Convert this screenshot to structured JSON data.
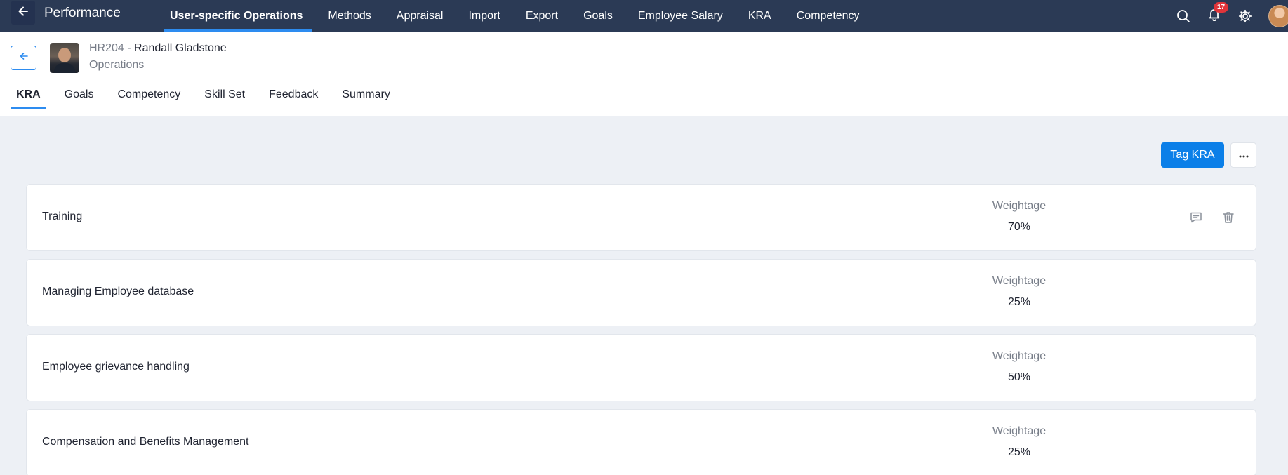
{
  "topbar": {
    "title": "Performance",
    "nav": [
      {
        "label": "User-specific Operations"
      },
      {
        "label": "Methods"
      },
      {
        "label": "Appraisal"
      },
      {
        "label": "Import"
      },
      {
        "label": "Export"
      },
      {
        "label": "Goals"
      },
      {
        "label": "Employee Salary"
      },
      {
        "label": "KRA"
      },
      {
        "label": "Competency"
      }
    ],
    "notification_count": "17"
  },
  "employee": {
    "id": "HR204",
    "separator": " - ",
    "name": "Randall Gladstone",
    "department": "Operations"
  },
  "tabs": [
    {
      "label": "KRA"
    },
    {
      "label": "Goals"
    },
    {
      "label": "Competency"
    },
    {
      "label": "Skill Set"
    },
    {
      "label": "Feedback"
    },
    {
      "label": "Summary"
    }
  ],
  "actions": {
    "tag_label": "Tag KRA"
  },
  "kras": [
    {
      "name": "Training",
      "weight_label": "Weightage",
      "weight": "70%"
    },
    {
      "name": "Managing Employee database",
      "weight_label": "Weightage",
      "weight": "25%"
    },
    {
      "name": "Employee grievance handling",
      "weight_label": "Weightage",
      "weight": "50%"
    },
    {
      "name": "Compensation and Benefits Management",
      "weight_label": "Weightage",
      "weight": "25%"
    }
  ],
  "colors": {
    "topbar": "#2b3a55",
    "accent": "#0b7fe8",
    "background": "#edf0f5",
    "badge": "#e0343a"
  },
  "icons": [
    "arrow-left-icon",
    "search-icon",
    "bell-icon",
    "gear-icon",
    "more-icon",
    "comment-icon",
    "trash-icon"
  ]
}
